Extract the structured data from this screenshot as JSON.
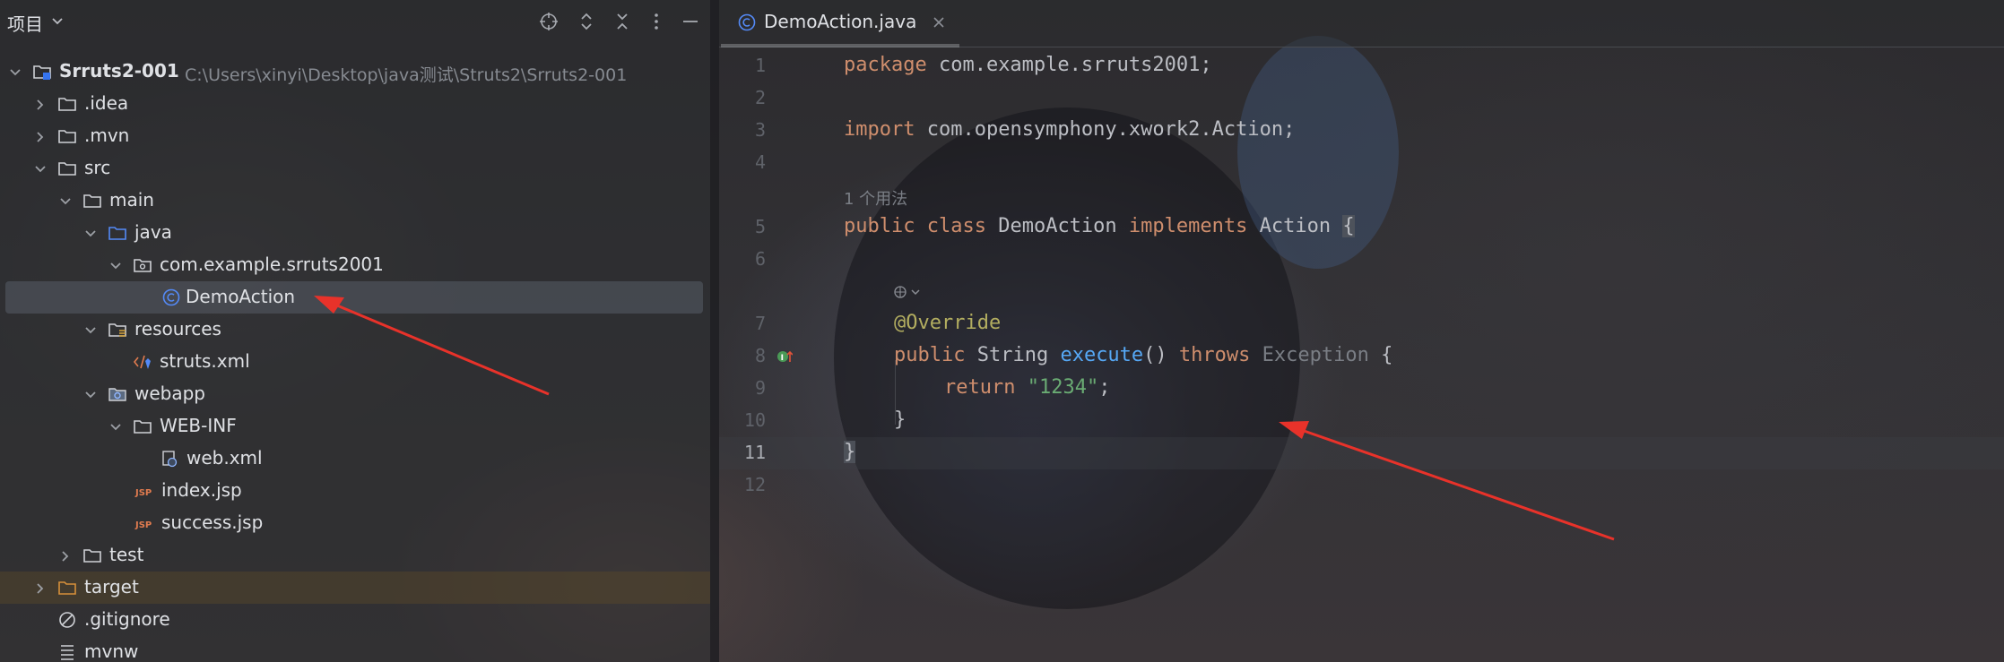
{
  "project_panel": {
    "title": "项目",
    "tree": [
      {
        "label": "Srruts2-001",
        "path": "C:\\Users\\xinyi\\Desktop\\java测试\\Struts2\\Srruts2-001",
        "icon": "module-folder-icon",
        "expanded": true
      },
      {
        "label": ".idea",
        "icon": "folder-icon",
        "expanded": false
      },
      {
        "label": ".mvn",
        "icon": "folder-icon",
        "expanded": false
      },
      {
        "label": "src",
        "icon": "folder-icon",
        "expanded": true
      },
      {
        "label": "main",
        "icon": "folder-icon",
        "expanded": true
      },
      {
        "label": "java",
        "icon": "source-folder-icon",
        "expanded": true
      },
      {
        "label": "com.example.srruts2001",
        "icon": "package-icon",
        "expanded": true
      },
      {
        "label": "DemoAction",
        "icon": "java-class-icon",
        "selected": true
      },
      {
        "label": "resources",
        "icon": "resources-folder-icon",
        "expanded": true
      },
      {
        "label": "struts.xml",
        "icon": "xml-file-icon"
      },
      {
        "label": "webapp",
        "icon": "web-folder-icon",
        "expanded": true
      },
      {
        "label": "WEB-INF",
        "icon": "folder-icon",
        "expanded": true
      },
      {
        "label": "web.xml",
        "icon": "web-xml-icon"
      },
      {
        "label": "index.jsp",
        "icon": "jsp-file-icon"
      },
      {
        "label": "success.jsp",
        "icon": "jsp-file-icon"
      },
      {
        "label": "test",
        "icon": "folder-icon",
        "expanded": false
      },
      {
        "label": "target",
        "icon": "excluded-folder-icon",
        "expanded": false
      },
      {
        "label": ".gitignore",
        "icon": "ignore-file-icon"
      },
      {
        "label": "mvnw",
        "icon": "file-icon"
      }
    ]
  },
  "editor": {
    "tab_label": "DemoAction.java",
    "usage_hint": "1 个用法",
    "line_numbers": [
      "1",
      "2",
      "3",
      "4",
      "5",
      "6",
      "7",
      "8",
      "9",
      "10",
      "11",
      "12"
    ],
    "code": {
      "l1_kw": "package",
      "l1_rest": " com.example.srruts2001;",
      "l3_kw": "import",
      "l3_rest": " com.opensymphony.xwork2.Action;",
      "l5_kw1": "public",
      "l5_kw2": "class",
      "l5_name": " DemoAction ",
      "l5_kw3": "implements",
      "l5_iface": " Action ",
      "l5_brace": "{",
      "l7_ann": "@Override",
      "l8_kw1": "public",
      "l8_type": " String ",
      "l8_fn": "execute",
      "l8_parens": "() ",
      "l8_kw2": "throws",
      "l8_exc": " Exception",
      "l8_brace": " {",
      "l9_kw": "return",
      "l9_str": "\"1234\"",
      "l9_semi": ";",
      "l10_close": "}",
      "l11_close": "}"
    }
  },
  "colors": {
    "keyword": "#cf8e6d",
    "annotation": "#b3ae60",
    "method": "#56a8f5",
    "string": "#6aab73",
    "arrow": "#e8322a"
  }
}
